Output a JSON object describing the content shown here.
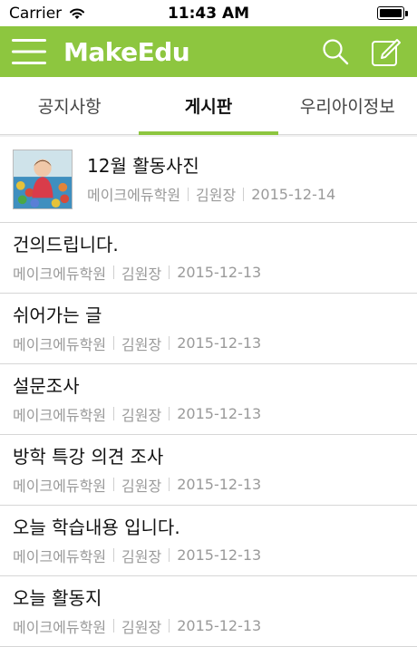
{
  "status_bar": {
    "carrier": "Carrier",
    "time": "11:43 AM"
  },
  "navbar": {
    "logo": "MakeEdu",
    "color": "#8dc63f"
  },
  "tabs": [
    {
      "label": "공지사항",
      "active": false
    },
    {
      "label": "게시판",
      "active": true
    },
    {
      "label": "우리아이정보",
      "active": false
    }
  ],
  "posts": [
    {
      "title": "12월 활동사진",
      "school": "메이크에듀학원",
      "author": "김원장",
      "date": "2015-12-14",
      "has_image": true
    },
    {
      "title": "건의드립니다.",
      "school": "메이크에듀학원",
      "author": "김원장",
      "date": "2015-12-13"
    },
    {
      "title": "쉬어가는 글",
      "school": "메이크에듀학원",
      "author": "김원장",
      "date": "2015-12-13"
    },
    {
      "title": "설문조사",
      "school": "메이크에듀학원",
      "author": "김원장",
      "date": "2015-12-13"
    },
    {
      "title": "방학 특강 의견 조사",
      "school": "메이크에듀학원",
      "author": "김원장",
      "date": "2015-12-13"
    },
    {
      "title": "오늘 학습내용 입니다.",
      "school": "메이크에듀학원",
      "author": "김원장",
      "date": "2015-12-13"
    },
    {
      "title": "오늘 활동지",
      "school": "메이크에듀학원",
      "author": "김원장",
      "date": "2015-12-13"
    }
  ]
}
